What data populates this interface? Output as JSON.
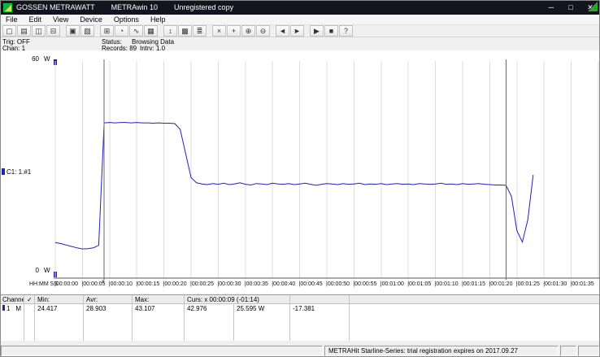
{
  "window": {
    "brand": "GOSSEN METRAWATT",
    "app": "METRAwin 10",
    "license": "Unregistered copy",
    "minimize": "─",
    "maximize": "□",
    "close": "✕"
  },
  "menu": [
    "File",
    "Edit",
    "View",
    "Device",
    "Options",
    "Help"
  ],
  "toolbar": [
    {
      "name": "new-icon",
      "glyph": "▢"
    },
    {
      "name": "open-icon",
      "glyph": "▤"
    },
    {
      "name": "save-icon",
      "glyph": "◫"
    },
    {
      "name": "print-icon",
      "glyph": "⊟"
    },
    {
      "sep": true
    },
    {
      "name": "copy-icon",
      "glyph": "▣"
    },
    {
      "name": "export-icon",
      "glyph": "▧"
    },
    {
      "sep": true
    },
    {
      "name": "digital-display-icon",
      "glyph": "⊞"
    },
    {
      "name": "analog-display-icon",
      "glyph": "◔"
    },
    {
      "name": "chart-view-icon",
      "glyph": "∿"
    },
    {
      "name": "table-view-icon",
      "glyph": "▦"
    },
    {
      "sep": true
    },
    {
      "name": "scale-icon",
      "glyph": "↕"
    },
    {
      "name": "grid-icon",
      "glyph": "▩"
    },
    {
      "name": "legend-icon",
      "glyph": "≣"
    },
    {
      "sep": true
    },
    {
      "name": "cursor-1-icon",
      "glyph": "×"
    },
    {
      "name": "cursor-2-icon",
      "glyph": "+"
    },
    {
      "name": "zoom-in-icon",
      "glyph": "⊕"
    },
    {
      "name": "zoom-out-icon",
      "glyph": "⊖"
    },
    {
      "sep": true
    },
    {
      "name": "device-read-icon",
      "glyph": "◄"
    },
    {
      "name": "device-send-icon",
      "glyph": "►"
    },
    {
      "sep": true
    },
    {
      "name": "start-measure-icon",
      "glyph": "▶"
    },
    {
      "name": "stop-measure-icon",
      "glyph": "■"
    },
    {
      "name": "help-icon",
      "glyph": "?"
    }
  ],
  "status_panel": {
    "trig": "Trig: OFF",
    "chan": "Chan: 1",
    "status_label": "Status:",
    "status_value": "Browsing Data",
    "records": "Records: 89",
    "interval": "Intrv: 1.0"
  },
  "chart": {
    "y_top_value": "60",
    "y_top_unit": "W",
    "y_bottom_value": "0",
    "y_bottom_unit": "W",
    "x_axis_caption": "HH:MM SS",
    "channel_label": "C1: 1.#1",
    "cursor1_marker": "x"
  },
  "chart_data": {
    "type": "line",
    "title": "",
    "xlabel": "HH:MM SS",
    "ylabel": "W",
    "ylim": [
      0,
      60
    ],
    "x_range_s": [
      0,
      100
    ],
    "tick_interval_s": 5,
    "sample_interval_s": 1.0,
    "records": 89,
    "grid": "vertical-only",
    "x_tick_labels": [
      "00:00:00",
      "00:00:05",
      "00:00:10",
      "00:00:15",
      "00:00:20",
      "00:00:25",
      "00:00:30",
      "00:00:35",
      "00:00:40",
      "00:00:45",
      "00:00:50",
      "00:00:55",
      "00:01:00",
      "00:01:05",
      "00:01:10",
      "00:01:15",
      "00:01:20",
      "00:01:25",
      "00:01:30",
      "00:01:35"
    ],
    "series": [
      {
        "name": "C1",
        "unit": "W",
        "color": "#2121bd",
        "values_w": [
          9.7,
          9.4,
          9.0,
          8.6,
          8.2,
          7.9,
          8.0,
          8.2,
          8.9,
          43.0,
          43.1,
          43.0,
          43.1,
          43.1,
          43.0,
          43.1,
          43.0,
          43.0,
          42.9,
          43.0,
          42.9,
          42.9,
          42.8,
          41.2,
          34.5,
          27.8,
          26.3,
          26.0,
          25.8,
          26.1,
          25.9,
          26.2,
          25.8,
          26.0,
          26.3,
          25.9,
          25.7,
          26.1,
          26.0,
          25.8,
          26.2,
          26.0,
          25.9,
          26.1,
          25.8,
          26.0,
          26.2,
          25.9,
          25.6,
          25.9,
          26.1,
          26.0,
          25.8,
          26.1,
          25.9,
          26.0,
          26.2,
          25.8,
          26.0,
          25.9,
          26.1,
          25.8,
          26.0,
          26.1,
          25.9,
          26.0,
          25.8,
          26.1,
          26.0,
          25.9,
          26.0,
          26.2,
          25.9,
          26.0,
          25.8,
          26.1,
          25.9,
          26.0,
          26.1,
          25.9,
          25.8,
          25.7,
          25.7,
          25.6,
          22.5,
          13.0,
          9.8,
          16.0,
          28.5
        ]
      }
    ],
    "cursors": [
      {
        "name": "cursor-1",
        "t_s": 9,
        "time": "00:00:09",
        "value_w": 42.976
      },
      {
        "name": "cursor-2",
        "t_s": 83,
        "time": "00:01:23",
        "value_w": 25.595
      }
    ],
    "stats_between_cursors": {
      "min_w": 24.417,
      "avr_w": 28.903,
      "max_w": 43.107,
      "delta_w": -17.381
    }
  },
  "table": {
    "header": {
      "channel": "Channel",
      "check": "✓",
      "min": "Min:",
      "avr": "Avr:",
      "max": "Max:",
      "curs": "Curs: x 00:00:09 (-01:14)"
    },
    "row": {
      "channel": "1",
      "flag": "M",
      "min": "24.417",
      "avr": "28.903",
      "max": "43.107",
      "curs1": "42.976",
      "curs2": "25.595 W",
      "delta": "-17.381"
    }
  },
  "statusbar": {
    "message": "METRAHit Starline-Series: trial registration expires on 2017.09.27"
  },
  "colors": {
    "line_blue": "#2121bd",
    "grid_gray": "#dcdcdc",
    "cursor_gray": "#6a6a6a",
    "titlebar_dark": "#14141f",
    "indicator_green": "#2fa32f"
  }
}
